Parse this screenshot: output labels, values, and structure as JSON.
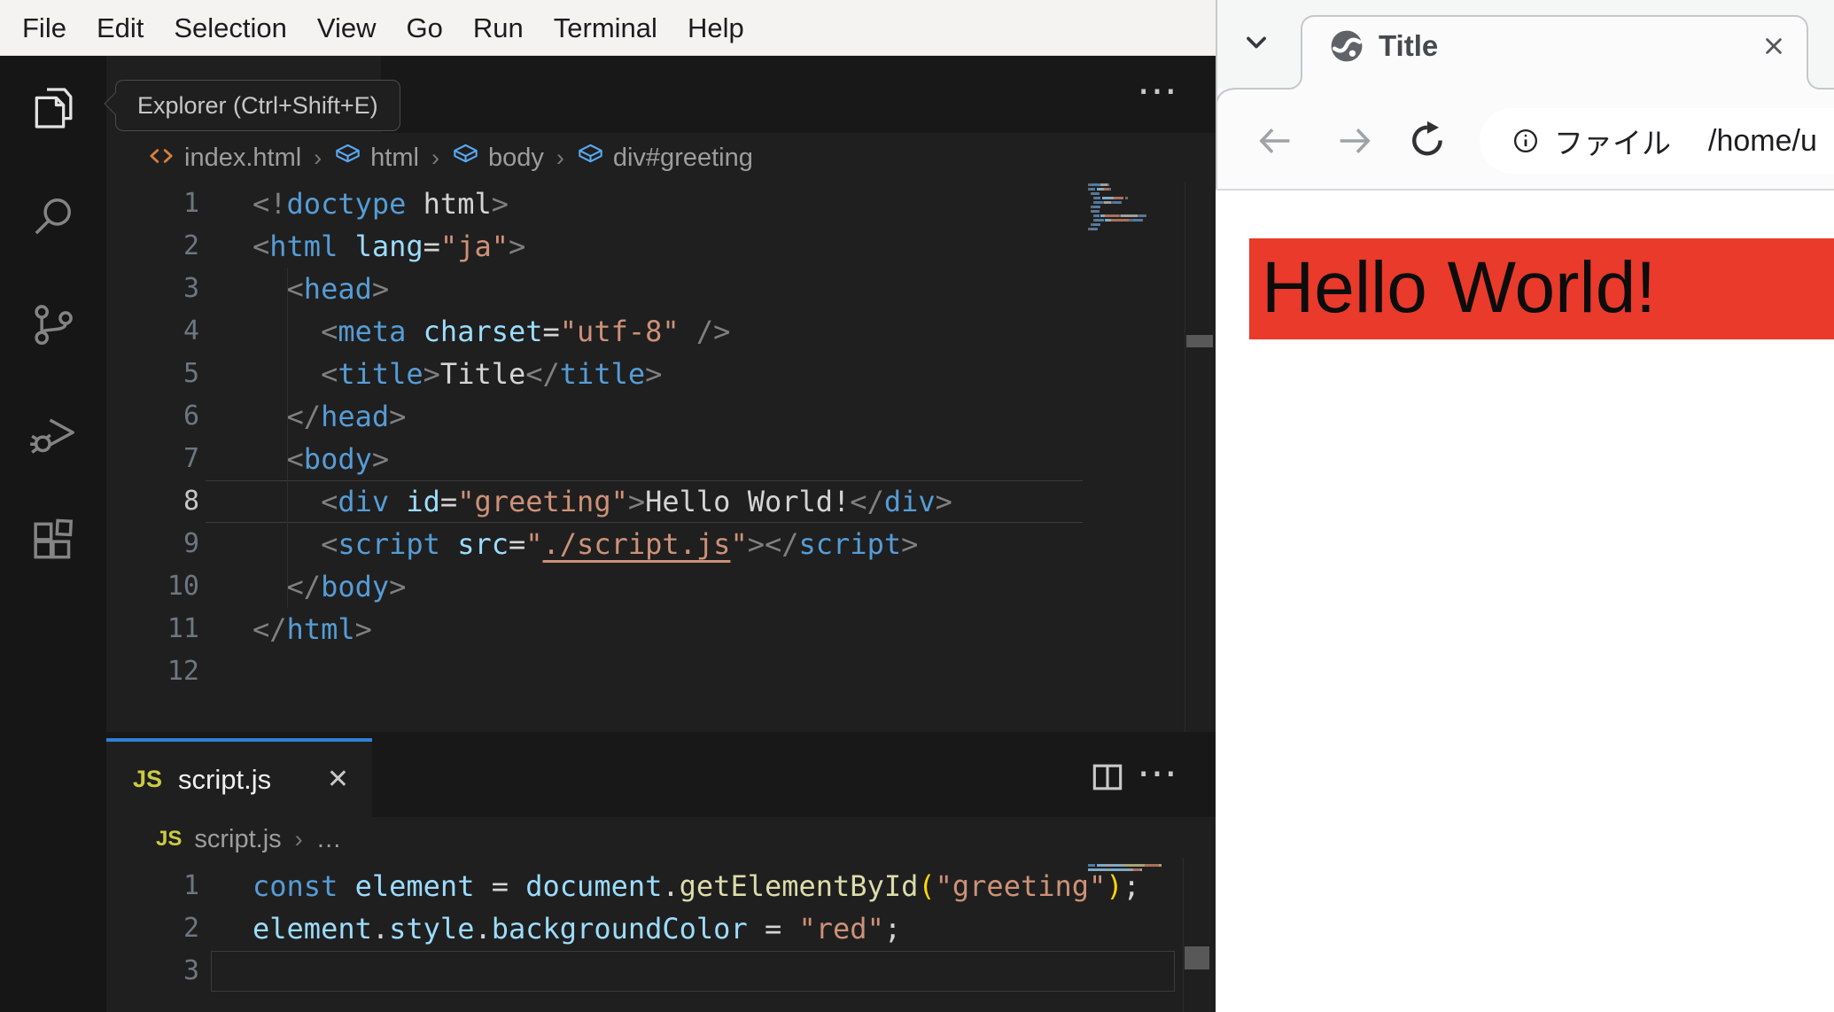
{
  "colors": {
    "accent_blue": "#2f81d7",
    "editor_background": "#1f1f1f",
    "tabstrip_background": "#181818",
    "activitybar_background": "#161616",
    "menubar_background": "#f4f3f2",
    "js_badge_yellow": "#cbcb41",
    "tag_blue": "#569cd6",
    "attr_lightblue": "#9cdcfe",
    "string_orange": "#ce9178",
    "method_yellow": "#dcdcaa",
    "paren_gold": "#ffd700",
    "banner_red": "#e93a2b"
  },
  "icons": {
    "more_actions": "⋯",
    "close": "✕",
    "js_badge": "JS",
    "breadcrumb_sep": "›",
    "ellipsis": "…"
  },
  "vscode": {
    "menubar_items": [
      "File",
      "Edit",
      "Selection",
      "View",
      "Go",
      "Run",
      "Terminal",
      "Help"
    ],
    "activity_items": [
      "explorer",
      "search",
      "source-control",
      "run-and-debug",
      "extensions"
    ],
    "tooltip": "Explorer (Ctrl+Shift+E)",
    "breadcrumb": [
      {
        "icon": "code",
        "label": "index.html"
      },
      {
        "icon": "cube",
        "label": "html"
      },
      {
        "icon": "cube",
        "label": "body"
      },
      {
        "icon": "cube",
        "label": "div#greeting"
      }
    ],
    "html_editor": {
      "active_line": 8,
      "lines": [
        [
          [
            "p",
            "<!"
          ],
          [
            "t",
            "doctype"
          ],
          [
            "x",
            " html"
          ],
          [
            "p",
            ">"
          ]
        ],
        [
          [
            "p",
            "<"
          ],
          [
            "t",
            "html"
          ],
          [
            "x",
            " "
          ],
          [
            "a",
            "lang"
          ],
          [
            "x",
            "="
          ],
          [
            "s",
            "\"ja\""
          ],
          [
            "p",
            ">"
          ]
        ],
        [
          [
            "x",
            "  "
          ],
          [
            "p",
            "<"
          ],
          [
            "t",
            "head"
          ],
          [
            "p",
            ">"
          ]
        ],
        [
          [
            "x",
            "    "
          ],
          [
            "p",
            "<"
          ],
          [
            "t",
            "meta"
          ],
          [
            "x",
            " "
          ],
          [
            "a",
            "charset"
          ],
          [
            "x",
            "="
          ],
          [
            "s",
            "\"utf-8\""
          ],
          [
            "x",
            " "
          ],
          [
            "p",
            "/>"
          ]
        ],
        [
          [
            "x",
            "    "
          ],
          [
            "p",
            "<"
          ],
          [
            "t",
            "title"
          ],
          [
            "p",
            ">"
          ],
          [
            "x",
            "Title"
          ],
          [
            "p",
            "</"
          ],
          [
            "t",
            "title"
          ],
          [
            "p",
            ">"
          ]
        ],
        [
          [
            "x",
            "  "
          ],
          [
            "p",
            "</"
          ],
          [
            "t",
            "head"
          ],
          [
            "p",
            ">"
          ]
        ],
        [
          [
            "x",
            "  "
          ],
          [
            "p",
            "<"
          ],
          [
            "t",
            "body"
          ],
          [
            "p",
            ">"
          ]
        ],
        [
          [
            "x",
            "    "
          ],
          [
            "p",
            "<"
          ],
          [
            "t",
            "div"
          ],
          [
            "x",
            " "
          ],
          [
            "a",
            "id"
          ],
          [
            "x",
            "="
          ],
          [
            "s",
            "\"greeting\""
          ],
          [
            "p",
            ">"
          ],
          [
            "x",
            "Hello World!"
          ],
          [
            "p",
            "</"
          ],
          [
            "t",
            "div"
          ],
          [
            "p",
            ">"
          ]
        ],
        [
          [
            "x",
            "    "
          ],
          [
            "p",
            "<"
          ],
          [
            "t",
            "script"
          ],
          [
            "x",
            " "
          ],
          [
            "a",
            "src"
          ],
          [
            "x",
            "="
          ],
          [
            "s",
            "\""
          ],
          [
            "su",
            "./script.js"
          ],
          [
            "s",
            "\""
          ],
          [
            "p",
            ">"
          ],
          [
            "p",
            "</"
          ],
          [
            "t",
            "script"
          ],
          [
            "p",
            ">"
          ]
        ],
        [
          [
            "x",
            "  "
          ],
          [
            "p",
            "</"
          ],
          [
            "t",
            "body"
          ],
          [
            "p",
            ">"
          ]
        ],
        [
          [
            "p",
            "</"
          ],
          [
            "t",
            "html"
          ],
          [
            "p",
            ">"
          ]
        ],
        []
      ]
    },
    "panel": {
      "tab": {
        "label": "script.js"
      },
      "breadcrumb_label": "script.js",
      "js_editor": {
        "active_line": 3,
        "lines": [
          [
            [
              "t",
              "const"
            ],
            [
              "x",
              " "
            ],
            [
              "a",
              "element"
            ],
            [
              "x",
              " = "
            ],
            [
              "a",
              "document"
            ],
            [
              "x",
              "."
            ],
            [
              "m",
              "getElementById"
            ],
            [
              "g",
              "("
            ],
            [
              "s",
              "\"greeting\""
            ],
            [
              "g",
              ")"
            ],
            [
              "x",
              ";"
            ]
          ],
          [
            [
              "a",
              "element"
            ],
            [
              "x",
              "."
            ],
            [
              "a",
              "style"
            ],
            [
              "x",
              "."
            ],
            [
              "a",
              "backgroundColor"
            ],
            [
              "x",
              " = "
            ],
            [
              "s",
              "\"red\""
            ],
            [
              "x",
              ";"
            ]
          ],
          []
        ]
      }
    }
  },
  "browser": {
    "tab_title": "Title",
    "address_chip": "ファイル",
    "address_path": "/home/u",
    "page": {
      "heading": "Hello World!"
    }
  }
}
